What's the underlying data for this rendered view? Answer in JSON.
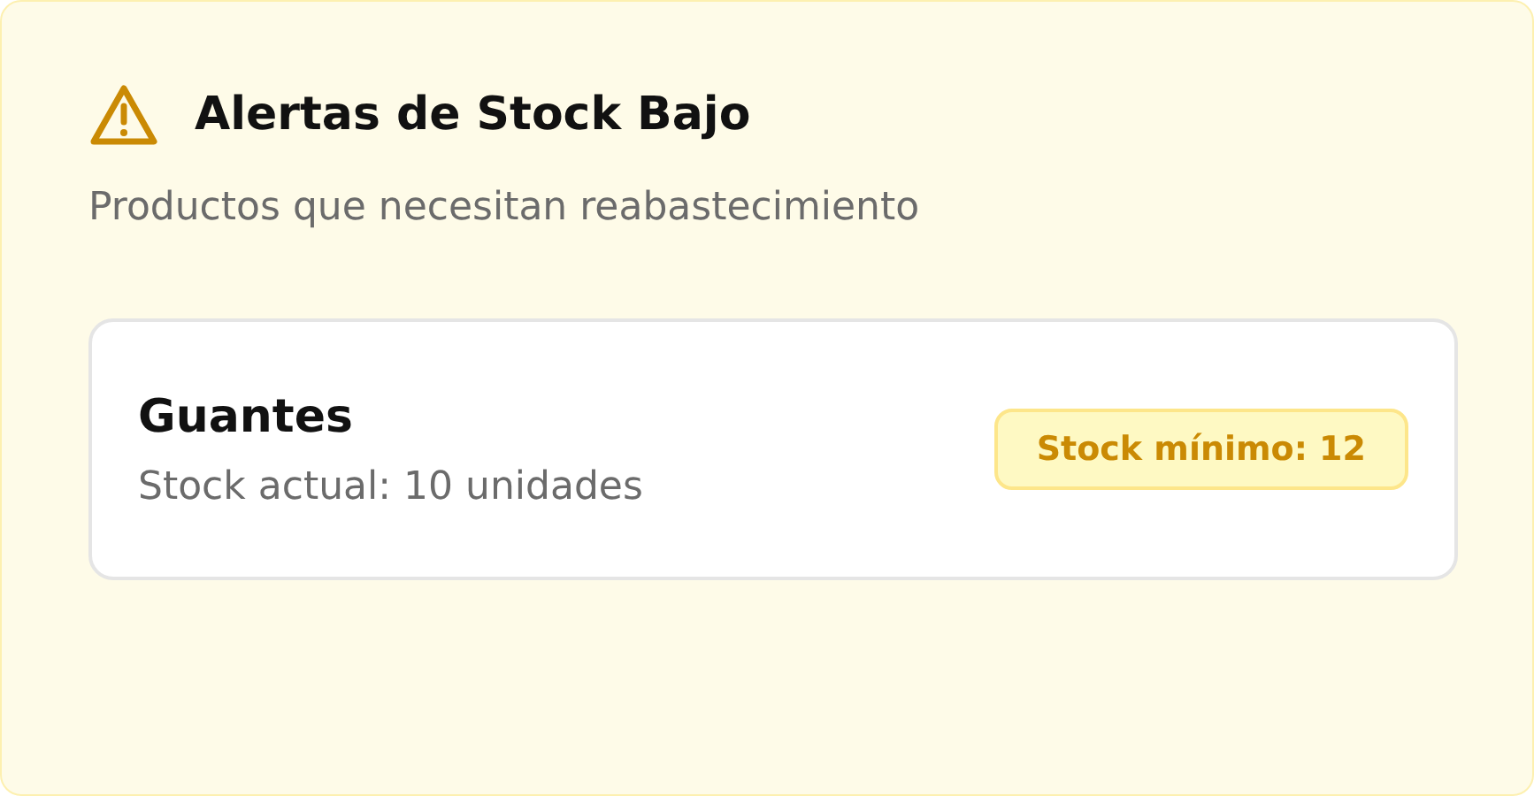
{
  "panel": {
    "title": "Alertas de Stock Bajo",
    "subtitle": "Productos que necesitan reabastecimiento"
  },
  "alerts": [
    {
      "name": "Guantes",
      "current": "Stock actual: 10 unidades",
      "badge": "Stock mínimo: 12"
    }
  ]
}
